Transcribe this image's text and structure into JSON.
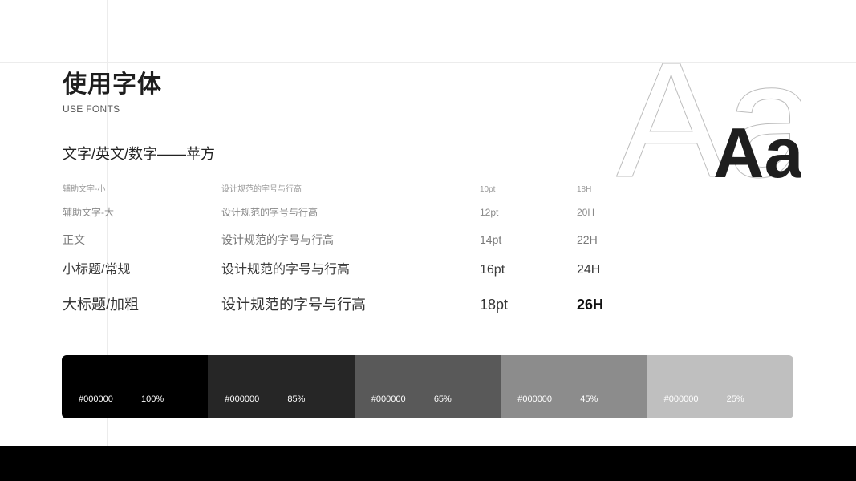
{
  "header": {
    "title": "使用字体",
    "subtitle": "USE FONTS",
    "font_line": "文字/英文/数字——苹方"
  },
  "spec_rows": [
    {
      "name": "辅助文字-小",
      "sample": "设计规范的字号与行高",
      "size": "10pt",
      "line_height": "18H"
    },
    {
      "name": "辅助文字-大",
      "sample": "设计规范的字号与行高",
      "size": "12pt",
      "line_height": "20H"
    },
    {
      "name": "正文",
      "sample": "设计规范的字号与行高",
      "size": "14pt",
      "line_height": "22H"
    },
    {
      "name": "小标题/常规",
      "sample": "设计规范的字号与行高",
      "size": "16pt",
      "line_height": "24H"
    },
    {
      "name": "大标题/加粗",
      "sample": "设计规范的字号与行高",
      "size": "18pt",
      "line_height": "26H"
    }
  ],
  "aa_display": {
    "outline_text": "Aa",
    "solid_text": "Aa"
  },
  "swatches": [
    {
      "hex": "#000000",
      "percent": "100%",
      "color": "#000000"
    },
    {
      "hex": "#000000",
      "percent": "85%",
      "color": "#262626"
    },
    {
      "hex": "#000000",
      "percent": "65%",
      "color": "#595959"
    },
    {
      "hex": "#000000",
      "percent": "45%",
      "color": "#8c8c8c"
    },
    {
      "hex": "#000000",
      "percent": "25%",
      "color": "#bfbfbf"
    }
  ]
}
